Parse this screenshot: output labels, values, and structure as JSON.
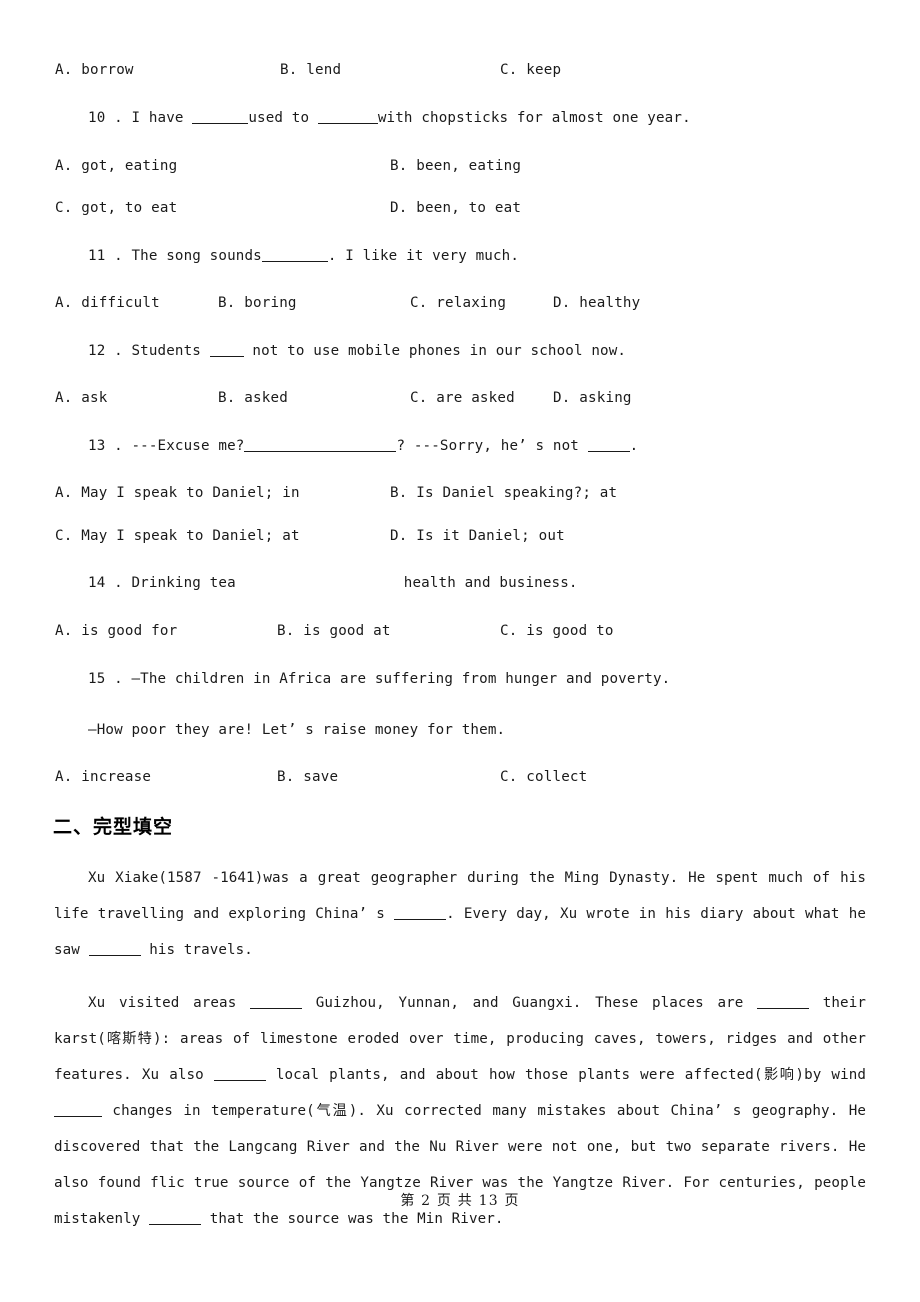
{
  "document": {
    "type": "english-exam-paper",
    "footer": "第 2 页 共 13 页"
  },
  "questions": [
    {
      "id": "q9-options",
      "stem": null,
      "layout": "three-column",
      "options": [
        "A. borrow",
        "B. lend",
        "C. keep"
      ]
    },
    {
      "id": "q10",
      "number": "10",
      "stem_pre": "10 . I have ",
      "stem_mid": "used to ",
      "stem_post": "with chopsticks for almost one year.",
      "layout": "two-column",
      "options": [
        "A. got, eating",
        "B. been, eating",
        "C. got, to eat",
        "D. been, to eat"
      ]
    },
    {
      "id": "q11",
      "number": "11",
      "stem_pre": "11 . The song sounds",
      "stem_post": ". I like it very much.",
      "layout": "four-column",
      "options": [
        "A. difficult",
        "B. boring",
        "C. relaxing",
        "D. healthy"
      ]
    },
    {
      "id": "q12",
      "number": "12",
      "stem_pre": "12 . Students ",
      "stem_post": " not to use mobile phones in our school now.",
      "layout": "four-column",
      "options": [
        "A. ask",
        "B. asked",
        "C. are asked",
        "D. asking"
      ]
    },
    {
      "id": "q13",
      "number": "13",
      "stem_pre": "13 . ---Excuse me?",
      "stem_mid": "?    ---Sorry, he’ s not ",
      "stem_post": ".",
      "layout": "two-column",
      "options": [
        "A. May I speak to Daniel; in",
        "B. Is Daniel speaking?; at",
        "C. May I speak to Daniel; at",
        "D. Is it Daniel; out"
      ]
    },
    {
      "id": "q14",
      "number": "14",
      "stem_pre": "14 . Drinking tea",
      "stem_post": "health and business.",
      "layout": "three-column",
      "options": [
        "A. is good for",
        "B. is good at",
        "C. is good to"
      ]
    },
    {
      "id": "q15",
      "number": "15",
      "stem_line1": "15 . —The children in Africa are suffering from hunger and poverty.",
      "stem_line2": "—How poor they are! Let’ s raise money for them.",
      "layout": "three-column",
      "options": [
        "A. increase",
        "B. save",
        "C. collect"
      ]
    }
  ],
  "section": {
    "heading": "二、完型填空"
  },
  "cloze": {
    "paragraph1_part1": "Xu Xiake(1587 -1641)was a great geographer during the Ming Dynasty. He spent much of his life travelling and exploring China’ s ",
    "paragraph1_part2": ". Every day, Xu wrote in his diary about what he saw ",
    "paragraph1_part3": " his travels.",
    "paragraph2_part1": "Xu visited areas ",
    "paragraph2_part2": " Guizhou, Yunnan, and Guangxi. These places are ",
    "paragraph2_part3": " their karst(喀斯特): areas of limestone eroded over time, producing caves, towers, ridges and other features. Xu also ",
    "paragraph2_part4": " local plants, and about how those plants were affected(影响)by wind ",
    "paragraph2_part5": " changes in temperature(气温). Xu corrected many mistakes about China’ s geography. He discovered that the Langcang River and the Nu River were not one, but two separate rivers. He also found flic true source of the Yangtze River was the Yangtze River. For centuries, people mistakenly ",
    "paragraph2_part6": " that the source was the Min River."
  }
}
